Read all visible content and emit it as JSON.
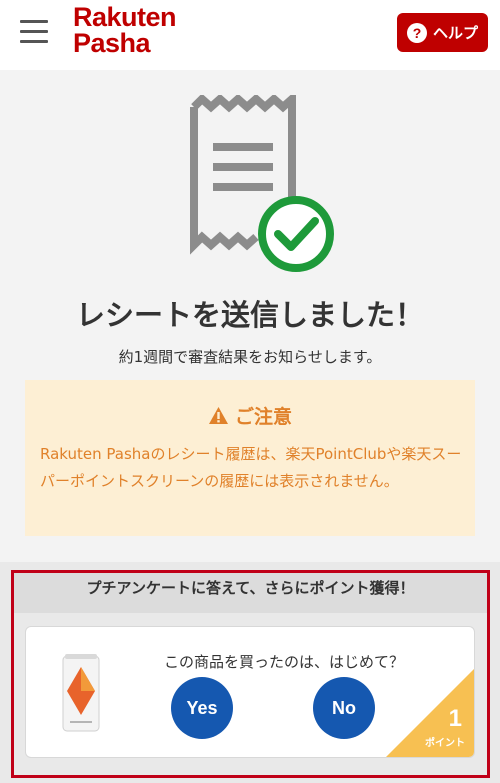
{
  "header": {
    "logo_line1": "Rakuten",
    "logo_line2": "Pasha",
    "help_label": "ヘルプ",
    "help_icon_glyph": "?"
  },
  "main": {
    "title": "レシートを送信しました！",
    "subtitle": "約1週間で審査結果をお知らせします。"
  },
  "notice": {
    "title": "ご注意",
    "body": "Rakuten Pashaのレシート履歴は、楽天PointClubや楽天スーパーポイントスクリーンの履歴には表示されません。"
  },
  "survey": {
    "header": "プチアンケートに答えて、さらにポイント獲得！",
    "question": "この商品を買ったのは、はじめて？",
    "yes_label": "Yes",
    "no_label": "No",
    "points_value": "1",
    "points_label": "ポイント"
  },
  "colors": {
    "brand": "#bf0000",
    "button_blue": "#1558b0",
    "notice_text": "#e0812a",
    "notice_bg": "#fdefd4",
    "check_green": "#1e9a3a",
    "points_badge": "#f7c052",
    "highlight_border": "#c00018"
  },
  "icons": [
    "hamburger-menu-icon",
    "help-question-icon",
    "receipt-icon",
    "check-circle-icon",
    "warning-icon",
    "product-can-image"
  ]
}
